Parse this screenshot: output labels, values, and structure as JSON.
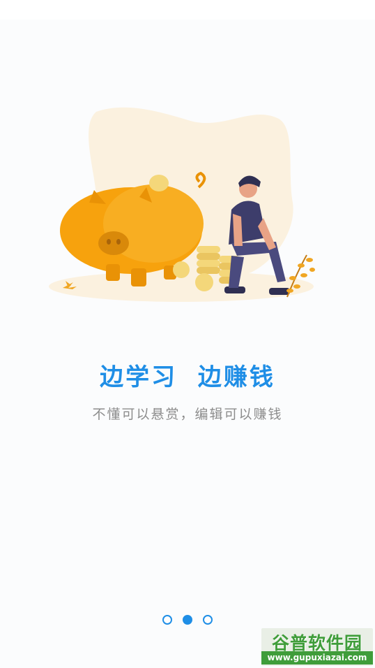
{
  "intro": {
    "headline": "边学习  边赚钱",
    "subline": "不懂可以悬赏，编辑可以赚钱"
  },
  "pager": {
    "page_count": 3,
    "active_index": 1
  },
  "watermark": {
    "logo_text": "谷普软件园",
    "url": "www.gupuxiazai.com"
  },
  "colors": {
    "accent": "#1f8ee6",
    "subtext": "#8c8c8c",
    "pig": "#f7a20d",
    "blob": "#fbf1df",
    "shirt": "#3d3d6b",
    "coin": "#f4d77a"
  }
}
